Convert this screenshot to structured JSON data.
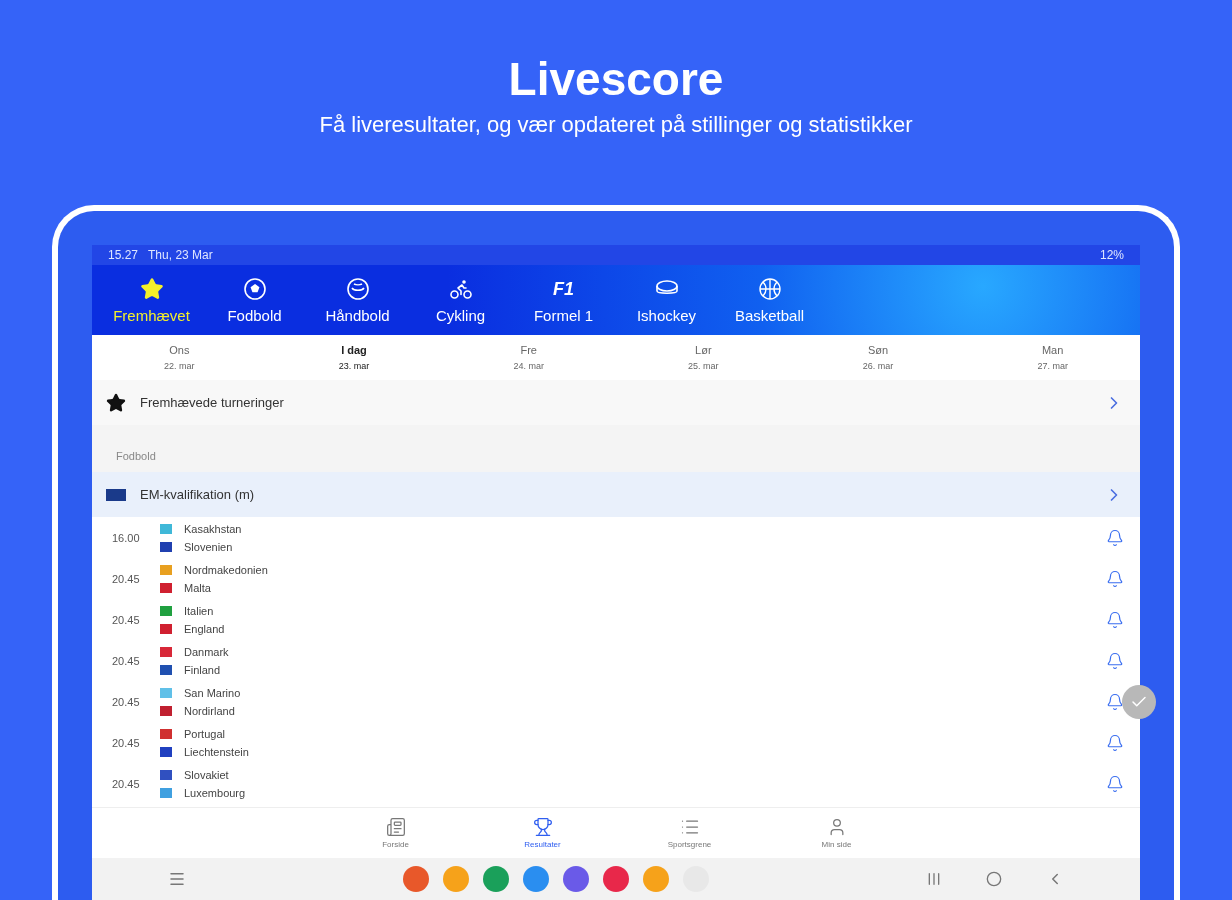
{
  "header": {
    "title": "Livescore",
    "subtitle": "Få liveresultater, og vær opdateret på stillinger og statistikker"
  },
  "status_bar": {
    "time": "15.27",
    "date": "Thu, 23 Mar",
    "battery": "12%"
  },
  "sport_tabs": [
    {
      "kind": "star",
      "label": "Fremhævet",
      "selected": true
    },
    {
      "kind": "football",
      "label": "Fodbold",
      "selected": false
    },
    {
      "kind": "handball",
      "label": "Håndbold",
      "selected": false
    },
    {
      "kind": "cycling",
      "label": "Cykling",
      "selected": false
    },
    {
      "kind": "f1",
      "icon_text": "F1",
      "label": "Formel 1",
      "selected": false
    },
    {
      "kind": "hockey",
      "label": "Ishockey",
      "selected": false
    },
    {
      "kind": "basketball",
      "label": "Basketball",
      "selected": false
    }
  ],
  "dates": [
    {
      "day": "Ons",
      "date": "22. mar",
      "selected": false
    },
    {
      "day": "I dag",
      "date": "23. mar",
      "selected": true
    },
    {
      "day": "Fre",
      "date": "24. mar",
      "selected": false
    },
    {
      "day": "Lør",
      "date": "25. mar",
      "selected": false
    },
    {
      "day": "Søn",
      "date": "26. mar",
      "selected": false
    },
    {
      "day": "Man",
      "date": "27. mar",
      "selected": false
    }
  ],
  "featured": {
    "label": "Fremhævede turneringer"
  },
  "section": {
    "label": "Fodbold"
  },
  "league": {
    "name": "EM-kvalifikation (m)"
  },
  "matches": [
    {
      "time": "16.00",
      "teams": [
        {
          "name": "Kasakhstan",
          "color": "#3fb8d8"
        },
        {
          "name": "Slovenien",
          "color": "#2040b0"
        }
      ]
    },
    {
      "time": "20.45",
      "teams": [
        {
          "name": "Nordmakedonien",
          "color": "#e8a020"
        },
        {
          "name": "Malta",
          "color": "#d02030"
        }
      ]
    },
    {
      "time": "20.45",
      "teams": [
        {
          "name": "Italien",
          "color": "#20a040"
        },
        {
          "name": "England",
          "color": "#d02030"
        }
      ]
    },
    {
      "time": "20.45",
      "teams": [
        {
          "name": "Danmark",
          "color": "#d82838"
        },
        {
          "name": "Finland",
          "color": "#2050b0"
        }
      ]
    },
    {
      "time": "20.45",
      "teams": [
        {
          "name": "San Marino",
          "color": "#60c0e8"
        },
        {
          "name": "Nordirland",
          "color": "#c02030"
        }
      ]
    },
    {
      "time": "20.45",
      "teams": [
        {
          "name": "Portugal",
          "color": "#d03030"
        },
        {
          "name": "Liechtenstein",
          "color": "#2040c0"
        }
      ]
    },
    {
      "time": "20.45",
      "teams": [
        {
          "name": "Slovakiet",
          "color": "#3050c0"
        },
        {
          "name": "Luxembourg",
          "color": "#40a0e0"
        }
      ]
    }
  ],
  "bottom_nav": [
    {
      "kind": "news",
      "label": "Forside",
      "selected": false
    },
    {
      "kind": "trophy",
      "label": "Resultater",
      "selected": true
    },
    {
      "kind": "list",
      "label": "Sportsgrene",
      "selected": false
    },
    {
      "kind": "user",
      "label": "Min side",
      "selected": false
    }
  ]
}
